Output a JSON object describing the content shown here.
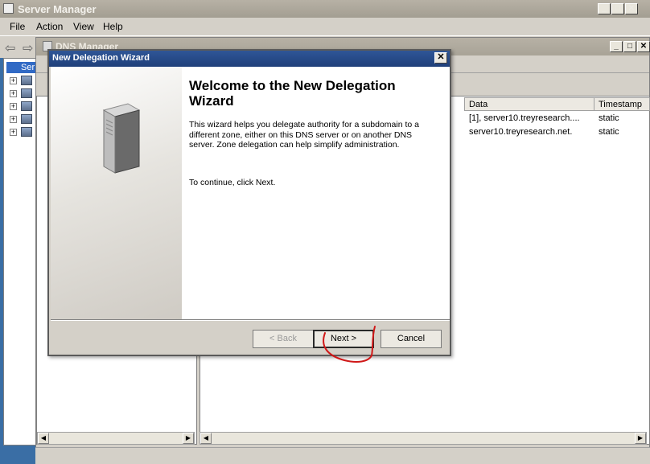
{
  "server_manager": {
    "title": "Server Manager",
    "menu": [
      "File",
      "Action",
      "View",
      "Help"
    ],
    "tree_root_label": "Ser"
  },
  "dns_manager": {
    "title": "DNS Manager",
    "columns": {
      "data": "Data",
      "timestamp": "Timestamp"
    },
    "rows": [
      {
        "data": "[1], server10.treyresearch....",
        "timestamp": "static"
      },
      {
        "data": "server10.treyresearch.net.",
        "timestamp": "static"
      }
    ]
  },
  "wizard": {
    "title": "New Delegation Wizard",
    "heading": "Welcome to the New Delegation Wizard",
    "description": "This wizard helps you delegate authority for a subdomain to a different zone, either on this DNS server or on another DNS server. Zone delegation can help simplify administration.",
    "continue_text": "To continue, click Next.",
    "buttons": {
      "back": "< Back",
      "next": "Next >",
      "cancel": "Cancel"
    },
    "back_enabled": false
  },
  "colors": {
    "wizard_titlebar": "#1f3f7a",
    "annotation": "#d01818",
    "desktop": "#3a6ea5"
  }
}
